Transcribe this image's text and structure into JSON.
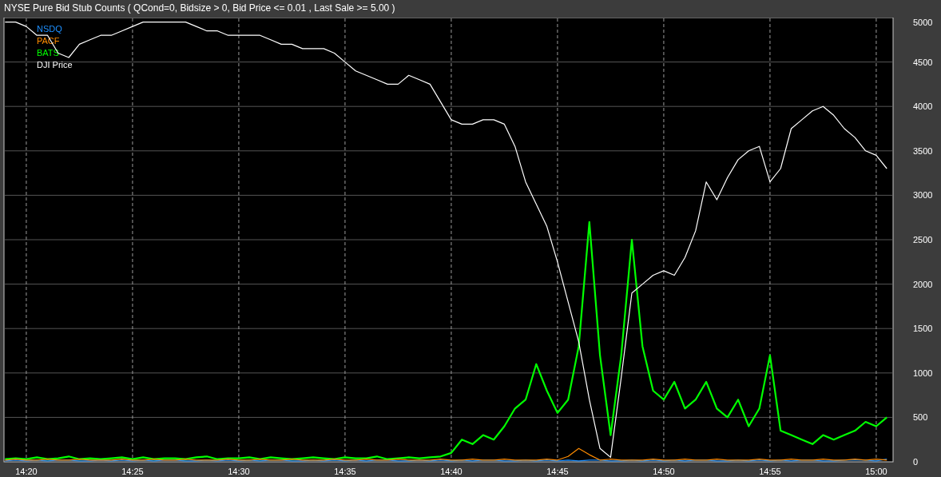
{
  "chart": {
    "chart_data": {
      "type": "line",
      "title": "NYSE Pure Bid Stub Counts ( QCond=0, Bidsize > 0, Bid Price <= 0.01 ,  Last Sale >= 5.00 )",
      "categories": [
        null,
        null,
        "14:20",
        null,
        null,
        null,
        null,
        null,
        null,
        null,
        null,
        null,
        "14:25",
        null,
        null,
        null,
        null,
        null,
        null,
        null,
        null,
        null,
        "14:30",
        null,
        null,
        null,
        null,
        null,
        null,
        null,
        null,
        null,
        "14:35",
        null,
        null,
        null,
        null,
        null,
        null,
        null,
        null,
        null,
        "14:40",
        null,
        null,
        null,
        null,
        null,
        null,
        null,
        null,
        null,
        "14:45",
        null,
        null,
        null,
        null,
        null,
        null,
        null,
        null,
        null,
        "14:50",
        null,
        null,
        null,
        null,
        null,
        null,
        null,
        null,
        null,
        "14:55",
        null,
        null,
        null,
        null,
        null,
        null,
        null,
        null,
        null,
        "15:00",
        null
      ],
      "series": [
        {
          "name": "NSDQ",
          "color": "#1e90ff",
          "values": [
            10,
            20,
            10,
            20,
            10,
            20,
            20,
            10,
            10,
            20,
            10,
            20,
            10,
            20,
            10,
            20,
            20,
            10,
            10,
            20,
            10,
            20,
            10,
            20,
            10,
            20,
            20,
            10,
            10,
            20,
            10,
            20,
            10,
            20,
            10,
            20,
            20,
            10,
            10,
            20,
            10,
            20,
            10,
            20,
            10,
            20,
            20,
            10,
            10,
            20,
            10,
            20,
            10,
            20,
            10,
            20,
            20,
            10,
            10,
            20,
            10,
            20,
            10,
            20,
            10,
            20,
            20,
            10,
            10,
            20,
            10,
            20,
            10,
            20,
            10,
            20,
            20,
            10,
            10,
            20,
            20,
            20,
            10,
            30
          ]
        },
        {
          "name": "PACF",
          "color": "#ff8c00",
          "values": [
            20,
            30,
            20,
            20,
            30,
            20,
            20,
            30,
            20,
            20,
            20,
            30,
            20,
            20,
            30,
            20,
            20,
            30,
            20,
            20,
            20,
            30,
            20,
            20,
            30,
            20,
            20,
            30,
            20,
            20,
            20,
            30,
            20,
            20,
            30,
            20,
            20,
            30,
            20,
            20,
            20,
            30,
            20,
            20,
            30,
            20,
            20,
            30,
            20,
            20,
            20,
            30,
            20,
            60,
            150,
            80,
            20,
            30,
            20,
            20,
            20,
            30,
            20,
            20,
            30,
            20,
            20,
            30,
            20,
            20,
            20,
            30,
            20,
            20,
            30,
            20,
            20,
            30,
            20,
            20,
            30,
            20,
            30,
            20
          ]
        },
        {
          "name": "BATS",
          "color": "#00ff00",
          "values": [
            30,
            40,
            30,
            50,
            30,
            40,
            60,
            30,
            40,
            30,
            40,
            50,
            30,
            50,
            30,
            40,
            40,
            30,
            50,
            60,
            30,
            40,
            40,
            50,
            30,
            50,
            40,
            30,
            40,
            50,
            40,
            30,
            50,
            40,
            40,
            60,
            30,
            40,
            50,
            40,
            50,
            60,
            100,
            250,
            200,
            300,
            250,
            400,
            600,
            700,
            1100,
            800,
            550,
            700,
            1300,
            2700,
            1200,
            300,
            1200,
            2500,
            1300,
            800,
            700,
            900,
            600,
            700,
            900,
            600,
            500,
            700,
            400,
            600,
            1200,
            350,
            300,
            250,
            200,
            300,
            250,
            300,
            350,
            450,
            400,
            500
          ]
        },
        {
          "name": "DJI Price",
          "color": "#ffffff",
          "values": [
            4950,
            4950,
            4900,
            4800,
            4800,
            4600,
            4550,
            4700,
            4750,
            4800,
            4800,
            4850,
            4900,
            4950,
            4950,
            4950,
            4950,
            4950,
            4900,
            4850,
            4850,
            4800,
            4800,
            4800,
            4800,
            4750,
            4700,
            4700,
            4650,
            4650,
            4650,
            4600,
            4500,
            4400,
            4350,
            4300,
            4250,
            4250,
            4350,
            4300,
            4250,
            4050,
            3850,
            3800,
            3800,
            3850,
            3850,
            3800,
            3550,
            3150,
            2900,
            2650,
            2250,
            1800,
            1350,
            700,
            150,
            50,
            950,
            1900,
            2000,
            2100,
            2150,
            2100,
            2300,
            2600,
            3150,
            2950,
            3200,
            3400,
            3500,
            3550,
            3150,
            3300,
            3750,
            3850,
            3950,
            4000,
            3900,
            3750,
            3650,
            3500,
            3450,
            3300
          ]
        }
      ],
      "ylim": [
        0,
        5000
      ],
      "grid": true,
      "yticks": [
        0,
        500,
        1000,
        1500,
        2000,
        2500,
        3000,
        3500,
        4000,
        4500,
        5000
      ]
    }
  }
}
